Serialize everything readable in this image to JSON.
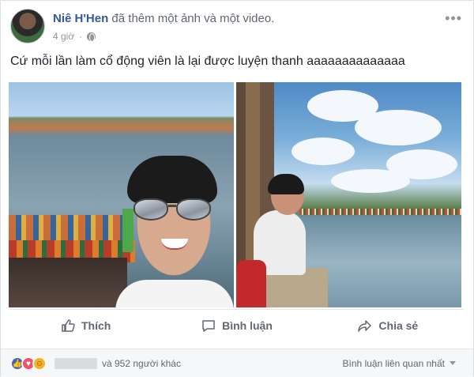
{
  "post": {
    "author": "Niê H'Hen",
    "action": "đã thêm một ảnh và một video.",
    "time": "4 giờ",
    "text": "Cứ mỗi lần làm cổ động viên là lại được luyện thanh aaaaaaaaaaaaaa",
    "more_icon": "•••"
  },
  "actions": {
    "like": "Thích",
    "comment": "Bình luận",
    "share": "Chia sẻ"
  },
  "footer": {
    "reaction_icons": [
      "like-icon",
      "love-icon",
      "haha-icon"
    ],
    "others": "và 952 người khác",
    "sort": "Bình luận liên quan nhất"
  },
  "colors": {
    "link": "#365899",
    "secondary": "#616770",
    "like": "#4267b2",
    "love": "#f25268",
    "haha": "#f7b125"
  }
}
